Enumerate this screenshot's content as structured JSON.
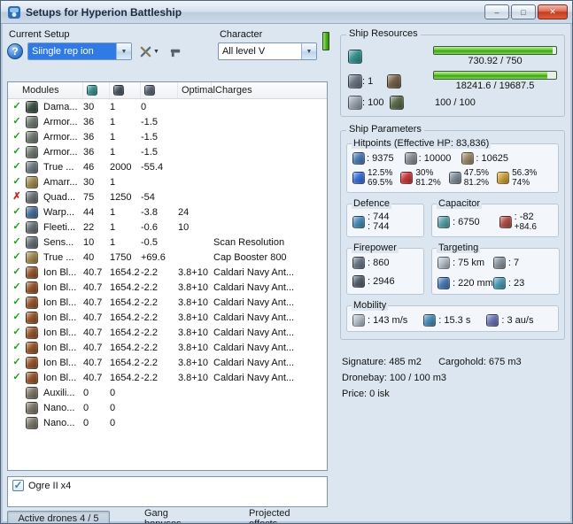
{
  "window": {
    "title": "Setups for Hyperion Battleship"
  },
  "toolbar": {
    "current_setup_label": "Current Setup",
    "setup_value": "Siingle rep ion",
    "character_label": "Character",
    "character_value": "All level V",
    "help_label": "?"
  },
  "modules_table": {
    "columns": {
      "modules": "Modules",
      "optimal": "Optimal",
      "charges": "Charges"
    },
    "rows": [
      {
        "status": "ok",
        "icon": "damage-control-icon",
        "color": "#3f5348",
        "name": "Dama...",
        "cpu": "30",
        "pg": "1",
        "cap": "0",
        "optimal": "",
        "charge": ""
      },
      {
        "status": "ok",
        "icon": "armor-hardener-icon",
        "color": "#6f7a72",
        "name": "Armor...",
        "cpu": "36",
        "pg": "1",
        "cap": "-1.5",
        "optimal": "",
        "charge": ""
      },
      {
        "status": "ok",
        "icon": "armor-hardener-icon",
        "color": "#6f7a72",
        "name": "Armor...",
        "cpu": "36",
        "pg": "1",
        "cap": "-1.5",
        "optimal": "",
        "charge": ""
      },
      {
        "status": "ok",
        "icon": "armor-hardener-icon",
        "color": "#6f7a72",
        "name": "Armor...",
        "cpu": "36",
        "pg": "1",
        "cap": "-1.5",
        "optimal": "",
        "charge": ""
      },
      {
        "status": "ok",
        "icon": "armor-repairer-icon",
        "color": "#707a84",
        "name": "True ...",
        "cpu": "46",
        "pg": "2000",
        "cap": "-55.4",
        "optimal": "",
        "charge": ""
      },
      {
        "status": "ok",
        "icon": "energized-membrane-icon",
        "color": "#a08a50",
        "name": "Amarr...",
        "cpu": "30",
        "pg": "1",
        "cap": "",
        "optimal": "",
        "charge": ""
      },
      {
        "status": "error",
        "icon": "booster-rockets-icon",
        "color": "#6d7278",
        "name": "Quad...",
        "cpu": "75",
        "pg": "1250",
        "cap": "-54",
        "optimal": "",
        "charge": ""
      },
      {
        "status": "ok",
        "icon": "warp-scrambler-icon",
        "color": "#4a6f9a",
        "name": "Warp...",
        "cpu": "44",
        "pg": "1",
        "cap": "-3.8",
        "optimal": "24",
        "charge": ""
      },
      {
        "status": "ok",
        "icon": "stasis-webifier-icon",
        "color": "#687078",
        "name": "Fleeti...",
        "cpu": "22",
        "pg": "1",
        "cap": "-0.6",
        "optimal": "10",
        "charge": ""
      },
      {
        "status": "ok",
        "icon": "sensor-booster-icon",
        "color": "#687078",
        "name": "Sens...",
        "cpu": "10",
        "pg": "1",
        "cap": "-0.5",
        "optimal": "",
        "charge": "Scan Resolution"
      },
      {
        "status": "ok",
        "icon": "cap-booster-icon",
        "color": "#a08a50",
        "name": "True ...",
        "cpu": "40",
        "pg": "1750",
        "cap": "+69.6",
        "optimal": "",
        "charge": "Cap Booster 800"
      },
      {
        "status": "ok",
        "icon": "ion-blaster-icon",
        "color": "#96562e",
        "name": "Ion Bl...",
        "cpu": "40.7",
        "pg": "1654.2",
        "cap": "-2.2",
        "optimal": "3.8+10",
        "charge": "Caldari Navy Ant..."
      },
      {
        "status": "ok",
        "icon": "ion-blaster-icon",
        "color": "#96562e",
        "name": "Ion Bl...",
        "cpu": "40.7",
        "pg": "1654.2",
        "cap": "-2.2",
        "optimal": "3.8+10",
        "charge": "Caldari Navy Ant..."
      },
      {
        "status": "ok",
        "icon": "ion-blaster-icon",
        "color": "#96562e",
        "name": "Ion Bl...",
        "cpu": "40.7",
        "pg": "1654.2",
        "cap": "-2.2",
        "optimal": "3.8+10",
        "charge": "Caldari Navy Ant..."
      },
      {
        "status": "ok",
        "icon": "ion-blaster-icon",
        "color": "#96562e",
        "name": "Ion Bl...",
        "cpu": "40.7",
        "pg": "1654.2",
        "cap": "-2.2",
        "optimal": "3.8+10",
        "charge": "Caldari Navy Ant..."
      },
      {
        "status": "ok",
        "icon": "ion-blaster-icon",
        "color": "#96562e",
        "name": "Ion Bl...",
        "cpu": "40.7",
        "pg": "1654.2",
        "cap": "-2.2",
        "optimal": "3.8+10",
        "charge": "Caldari Navy Ant..."
      },
      {
        "status": "ok",
        "icon": "ion-blaster-icon",
        "color": "#96562e",
        "name": "Ion Bl...",
        "cpu": "40.7",
        "pg": "1654.2",
        "cap": "-2.2",
        "optimal": "3.8+10",
        "charge": "Caldari Navy Ant..."
      },
      {
        "status": "ok",
        "icon": "ion-blaster-icon",
        "color": "#96562e",
        "name": "Ion Bl...",
        "cpu": "40.7",
        "pg": "1654.2",
        "cap": "-2.2",
        "optimal": "3.8+10",
        "charge": "Caldari Navy Ant..."
      },
      {
        "status": "ok",
        "icon": "ion-blaster-icon",
        "color": "#96562e",
        "name": "Ion Bl...",
        "cpu": "40.7",
        "pg": "1654.2",
        "cap": "-2.2",
        "optimal": "3.8+10",
        "charge": "Caldari Navy Ant..."
      },
      {
        "status": "none",
        "icon": "rig-icon",
        "color": "#7d766b",
        "name": "Auxili...",
        "cpu": "0",
        "pg": "0",
        "cap": "",
        "optimal": "",
        "charge": ""
      },
      {
        "status": "none",
        "icon": "rig-icon",
        "color": "#7d766b",
        "name": "Nano...",
        "cpu": "0",
        "pg": "0",
        "cap": "",
        "optimal": "",
        "charge": ""
      },
      {
        "status": "none",
        "icon": "rig-icon",
        "color": "#7d766b",
        "name": "Nano...",
        "cpu": "0",
        "pg": "0",
        "cap": "",
        "optimal": "",
        "charge": ""
      }
    ]
  },
  "drones": {
    "label": "Ogre II x4",
    "checked": true
  },
  "tabs": [
    {
      "id": "active-drones",
      "label": "Active drones 4 / 5",
      "active": true
    },
    {
      "id": "gang-bonuses",
      "label": "Gang bonuses",
      "active": false
    },
    {
      "id": "projected-effects",
      "label": "Projected effects",
      "active": false
    }
  ],
  "ship_resources": {
    "title": "Ship Resources",
    "cpu_text": "730.92 / 750",
    "cpu_pct": 97,
    "pg_text": "18241.6 / 19687.5",
    "pg_pct": 93,
    "turret_hardpoints": "1",
    "calibration": "100",
    "drone_bandwidth": "100 / 100"
  },
  "ship_parameters": {
    "title": "Ship Parameters",
    "hitpoints": {
      "title": "Hitpoints (Effective HP: 83,836)",
      "pools": [
        {
          "icon": "shield-icon",
          "color": "#4a7ab5",
          "value": "9375"
        },
        {
          "icon": "armor-icon",
          "color": "#8a8f96",
          "value": "10000"
        },
        {
          "icon": "hull-icon",
          "color": "#9a8a6a",
          "value": "10625"
        }
      ],
      "resists": [
        {
          "icon": "em-resist-icon",
          "color": "#3b6fd4",
          "shield": "12.5%",
          "armor": "69.5%"
        },
        {
          "icon": "thermal-resist-icon",
          "color": "#c43b3b",
          "shield": "30%",
          "armor": "81.2%"
        },
        {
          "icon": "kinetic-resist-icon",
          "color": "#7f8c98",
          "shield": "47.5%",
          "armor": "81.2%"
        },
        {
          "icon": "explosive-resist-icon",
          "color": "#caa13b",
          "shield": "56.3%",
          "armor": "74%"
        }
      ]
    },
    "defence": {
      "title": "Defence",
      "value_top": "744",
      "value_bottom": "744"
    },
    "capacitor": {
      "title": "Capacitor",
      "capacity": "6750",
      "delta": "-82",
      "recharge": "+84.6"
    },
    "firepower": {
      "title": "Firepower",
      "volley": "860",
      "dps": "2946"
    },
    "targeting": {
      "title": "Targeting",
      "range": "75 km",
      "max_targets": "7",
      "scan_resolution": "220 mm",
      "sensor_strength": "23"
    },
    "mobility": {
      "title": "Mobility",
      "speed": "143 m/s",
      "align_time": "15.3 s",
      "warp_speed": "3 au/s"
    }
  },
  "footer": {
    "signature": "Signature: 485 m2",
    "cargohold": "Cargohold: 675 m3",
    "dronebay": "Dronebay: 100 / 100 m3",
    "price": "Price: 0 isk"
  },
  "icons": {
    "cpu": {
      "color": "#3a9090"
    },
    "powergrid": {
      "color": "#4a5560"
    },
    "cap-use": {
      "color": "#5a6272"
    },
    "turret-slot": {
      "color": "#6a7585"
    },
    "launcher-slot": {
      "color": "#76614a"
    },
    "calibration": {
      "color": "#9aa4ae"
    },
    "drone-bandwidth": {
      "color": "#5a6a4a"
    },
    "defence": {
      "color": "#4a8ab5"
    },
    "cap-capacity": {
      "color": "#58a0a8"
    },
    "cap-recharge": {
      "color": "#b05048"
    },
    "turret": {
      "color": "#6a7585"
    },
    "dps": {
      "color": "#55606e"
    },
    "target-range": {
      "color": "#b3bcc6"
    },
    "max-targets": {
      "color": "#8a94a0"
    },
    "scan-res": {
      "color": "#4a7ab5"
    },
    "sensor-strength": {
      "color": "#4a9ab5"
    },
    "speed": {
      "color": "#b3bcc6"
    },
    "align": {
      "color": "#4a8ab5"
    },
    "warp": {
      "color": "#6a75b5"
    },
    "status_ok_color": "#18a018",
    "status_error_color": "#d02020"
  }
}
